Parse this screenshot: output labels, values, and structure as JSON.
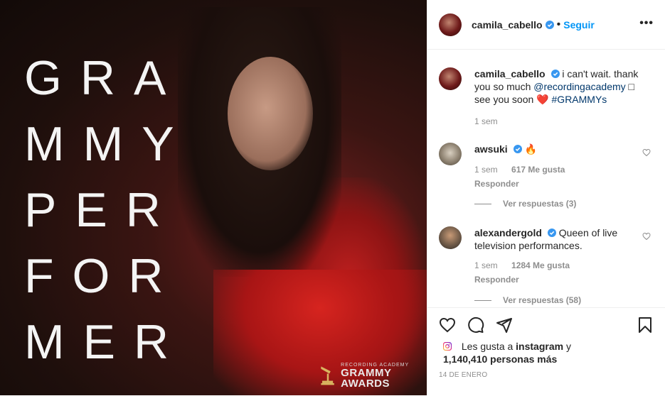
{
  "post_image": {
    "poster_text_lines": [
      "GRA",
      "MMY",
      "PER",
      "FOR",
      "MER"
    ],
    "badge_top": "RECORDING ACADEMY",
    "badge_main": "GRAMMY AWARDS"
  },
  "header": {
    "username": "camila_cabello",
    "separator": "•",
    "follow_label": "Seguir",
    "more_label": "•••"
  },
  "caption": {
    "username": "camila_cabello",
    "text_before": "i can't wait. thank you so much",
    "mention": "@recordingacademy",
    "text_after": "□ see you soon",
    "heart_emoji": "❤️",
    "hashtag": "#GRAMMYs",
    "time": "1 sem"
  },
  "comments": [
    {
      "username": "awsuki",
      "text": "🔥",
      "time": "1 sem",
      "likes": "617 Me gusta",
      "reply_label": "Responder",
      "view_replies": "Ver respuestas (3)"
    },
    {
      "username": "alexandergold",
      "text": "Queen of live television performances.",
      "time": "1 sem",
      "likes": "1284 Me gusta",
      "reply_label": "Responder",
      "view_replies": "Ver respuestas (58)"
    }
  ],
  "likes_line": {
    "prefix": "Les gusta a",
    "user": "instagram",
    "conj": "y",
    "count": "1,140,410 personas más"
  },
  "date": "14 DE ENERO",
  "colors": {
    "link_blue": "#0095f6",
    "mention_blue": "#00376b",
    "verified_blue": "#3897f0",
    "muted": "#8e8e8e"
  },
  "icons": [
    "heart-icon",
    "comment-icon",
    "share-icon",
    "bookmark-icon",
    "more-icon",
    "verified-icon",
    "instagram-icon"
  ]
}
